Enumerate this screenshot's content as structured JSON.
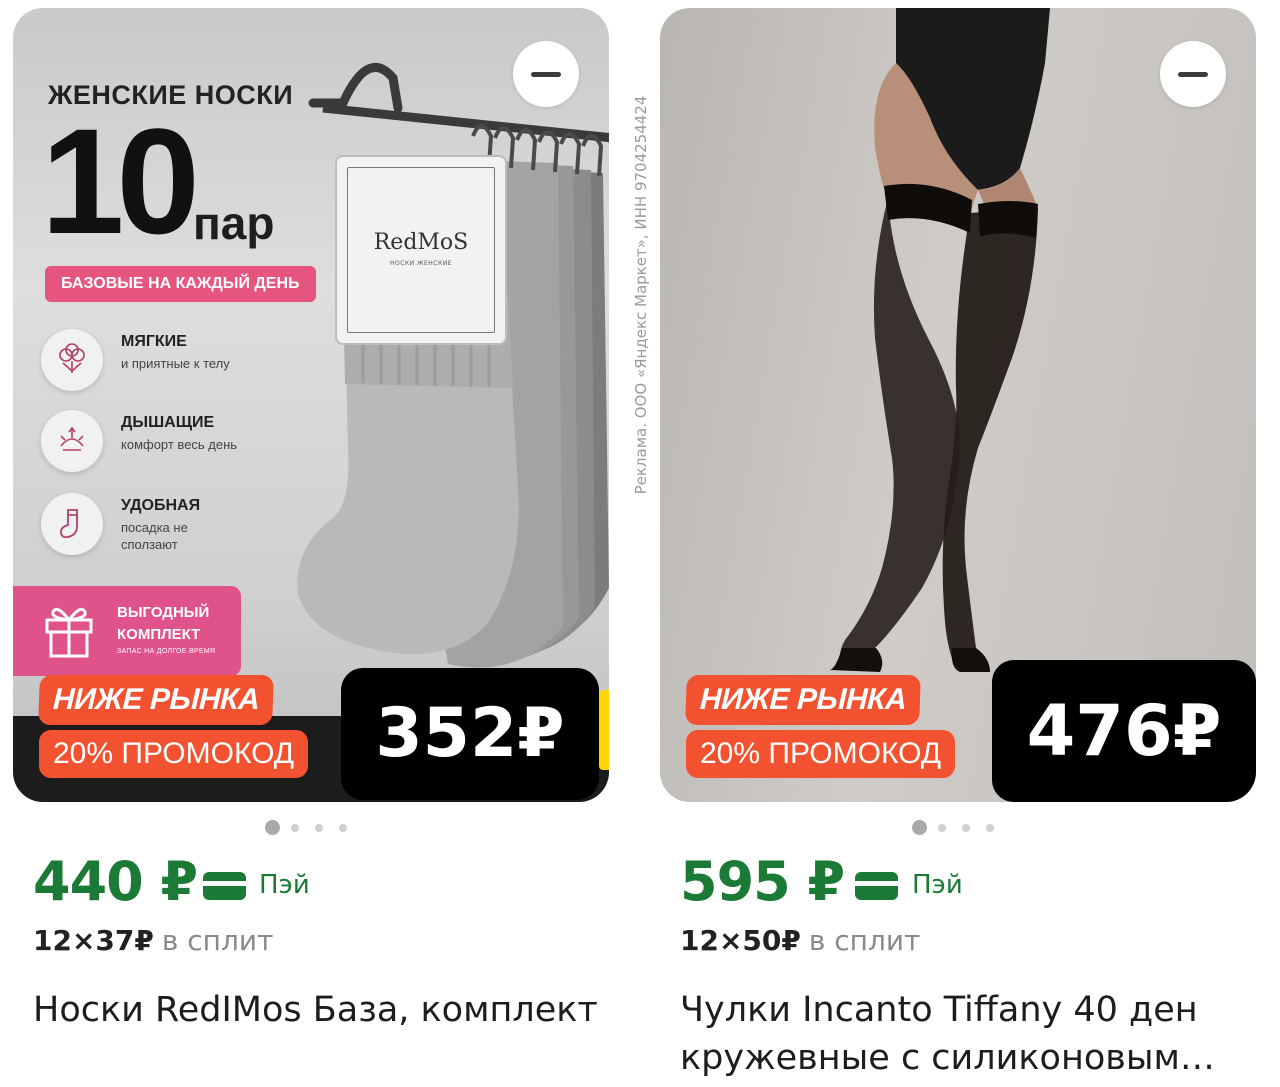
{
  "ad_disclaimer": "Реклама. ООО «Яндекс Маркет», ИНН 9704254424",
  "products": [
    {
      "image": {
        "headline": "ЖЕНСКИЕ НОСКИ",
        "count": "10",
        "unit": "пар",
        "ribbon": "БАЗОВЫЕ НА КАЖДЫЙ ДЕНЬ",
        "brand_tag": "RedMoS",
        "brand_tag_sub": "НОСКИ ЖЕНСКИЕ",
        "features": [
          {
            "title": "МЯГКИЕ",
            "text": "и приятные к телу",
            "icon": "cotton-icon"
          },
          {
            "title": "ДЫШАЩИЕ",
            "text": "комфорт весь день",
            "icon": "breathable-icon"
          },
          {
            "title": "УДОБНАЯ",
            "text": "посадка не сползают",
            "icon": "sock-icon"
          }
        ],
        "bonus_title": "ВЫГОДНЫЙ КОМПЛЕКТ",
        "bonus_sub": "ЗАПАС НА ДОЛГОЕ ВРЕМЯ",
        "badge_market": "НИЖЕ РЫНКА",
        "badge_promo": "20% ПРОМОКОД",
        "promo_price": "352₽"
      },
      "pagination": {
        "total": 4,
        "active": 0
      },
      "price": "440 ₽",
      "pay_label": "Пэй",
      "split_amount": "12×37₽",
      "split_label": "в сплит",
      "title": "Носки RedIMos База, комплект"
    },
    {
      "image": {
        "badge_market": "НИЖЕ РЫНКА",
        "badge_promo": "20% ПРОМОКОД",
        "promo_price": "476₽"
      },
      "pagination": {
        "total": 4,
        "active": 0
      },
      "price": "595 ₽",
      "pay_label": "Пэй",
      "split_amount": "12×50₽",
      "split_label": "в сплит",
      "title": "Чулки Incanto Tiffany 40 ден кружевные с силиконовым…"
    }
  ],
  "colors": {
    "price_green": "#1a7a36",
    "badge_orange": "#f2522f",
    "promo_pink": "#e5557e"
  }
}
